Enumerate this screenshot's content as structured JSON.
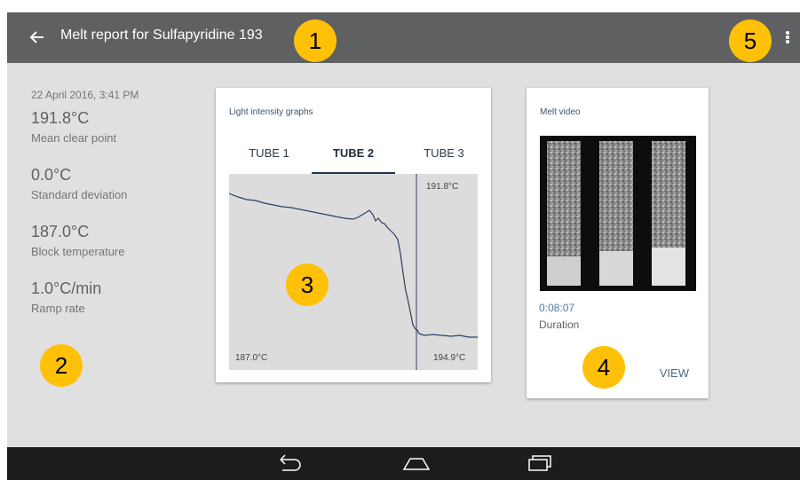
{
  "header": {
    "title": "Melt report for Sulfapyridine 193"
  },
  "callouts": [
    "1",
    "2",
    "3",
    "4",
    "5"
  ],
  "summary": {
    "date": "22 April 2016, 3:41 PM",
    "stats": [
      {
        "value": "191.8°C",
        "label": "Mean clear point"
      },
      {
        "value": "0.0°C",
        "label": "Standard deviation"
      },
      {
        "value": "187.0°C",
        "label": "Block temperature"
      },
      {
        "value": "1.0°C/min",
        "label": "Ramp rate"
      }
    ]
  },
  "graph_card": {
    "title": "Light intensity graphs",
    "tabs": [
      "TUBE 1",
      "TUBE 2",
      "TUBE 3"
    ],
    "active_tab": "TUBE 2",
    "clear_point_label": "191.8°C",
    "start_label": "187.0°C",
    "end_label": "194.9°C"
  },
  "video_card": {
    "title": "Melt video",
    "duration_value": "0:08:07",
    "duration_label": "Duration",
    "view_label": "VIEW"
  },
  "icons": {
    "back": "arrow-left-icon",
    "menu": "more-vert-icon",
    "nav_back": "back-icon",
    "nav_home": "home-icon",
    "nav_recents": "recents-icon"
  },
  "colors": {
    "appbar": "#5f6062",
    "callout": "#ffc107",
    "background": "#e0e0e0",
    "trace": "#2b3f63"
  }
}
